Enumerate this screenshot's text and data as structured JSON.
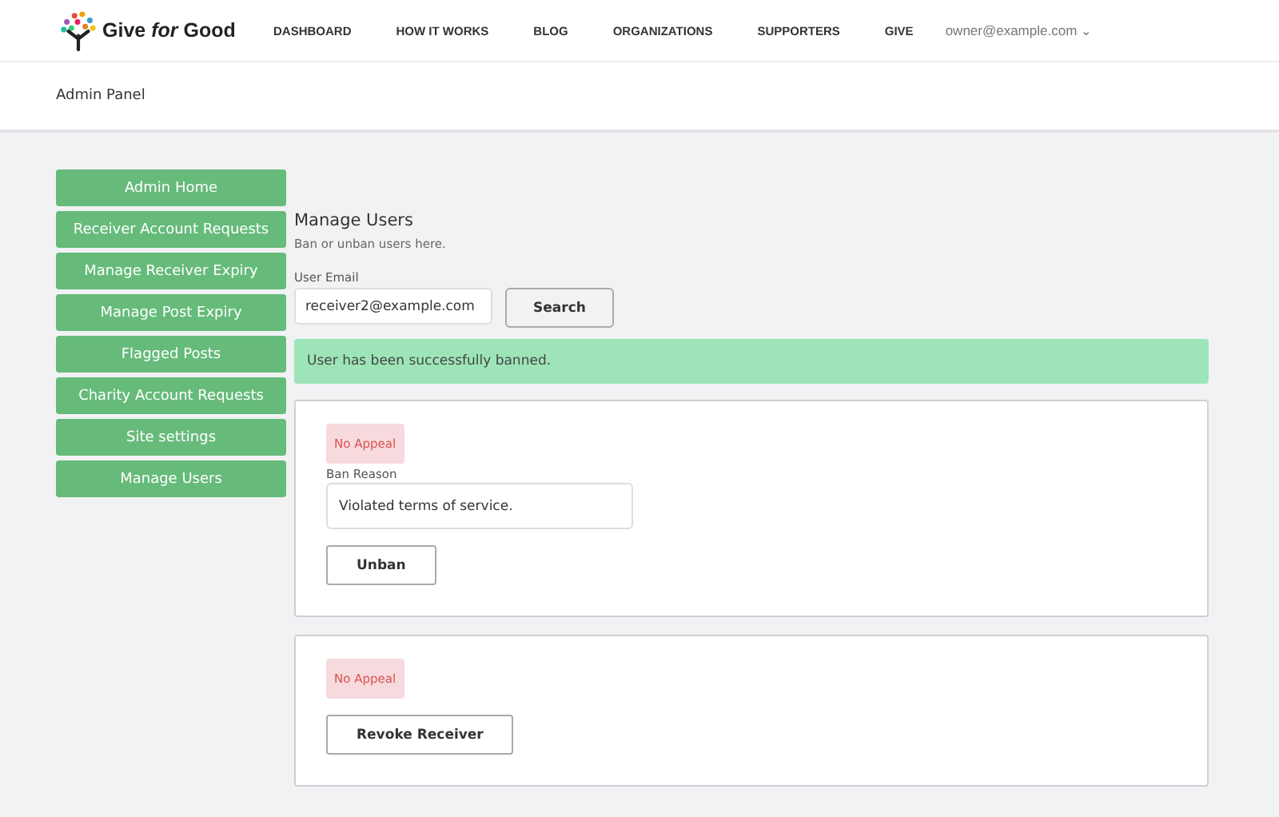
{
  "brand": {
    "name": "Give *for* Good"
  },
  "nav": [
    {
      "label": "DASHBOARD"
    },
    {
      "label": "HOW IT WORKS"
    },
    {
      "label": "BLOG"
    },
    {
      "label": "ORGANIZATIONS"
    },
    {
      "label": "SUPPORTERS"
    },
    {
      "label": "GIVE"
    }
  ],
  "account": {
    "label": "owner@example.com",
    "caret": "⌄"
  },
  "page_title": "Admin Panel",
  "sidebar": {
    "items": [
      {
        "label": "Admin Home"
      },
      {
        "label": "Receiver Account Requests"
      },
      {
        "label": "Manage Receiver Expiry"
      },
      {
        "label": "Manage Post Expiry"
      },
      {
        "label": "Flagged Posts"
      },
      {
        "label": "Charity Account Requests"
      },
      {
        "label": "Site settings"
      },
      {
        "label": "Manage Users"
      }
    ]
  },
  "manage_users": {
    "title": "Manage Users",
    "subtitle": "Ban or unban users here.",
    "email_label": "User Email",
    "email_value": "receiver2@example.com",
    "search_button": "Search",
    "alert": "User has been successfully banned."
  },
  "cards": [
    {
      "badge": "No Appeal",
      "reason_label": "Ban Reason",
      "reason_value": "Violated terms of service.",
      "button": "Unban"
    },
    {
      "badge": "No Appeal",
      "button": "Revoke Receiver"
    }
  ]
}
